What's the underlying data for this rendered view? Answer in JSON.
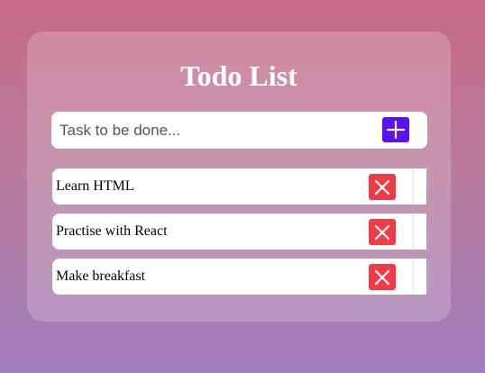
{
  "app": {
    "title": "Todo List"
  },
  "input": {
    "placeholder": "Task to be done...",
    "value": ""
  },
  "buttons": {
    "add_icon": "plus-icon",
    "delete_icon": "close-icon"
  },
  "tasks": [
    {
      "text": "Learn HTML"
    },
    {
      "text": "Practise with React"
    },
    {
      "text": "Make breakfast"
    }
  ],
  "colors": {
    "add_button": "#5a10f0",
    "delete_button": "#f43a44",
    "background_top": "#c76a86",
    "background_bottom": "#a07cbc"
  }
}
